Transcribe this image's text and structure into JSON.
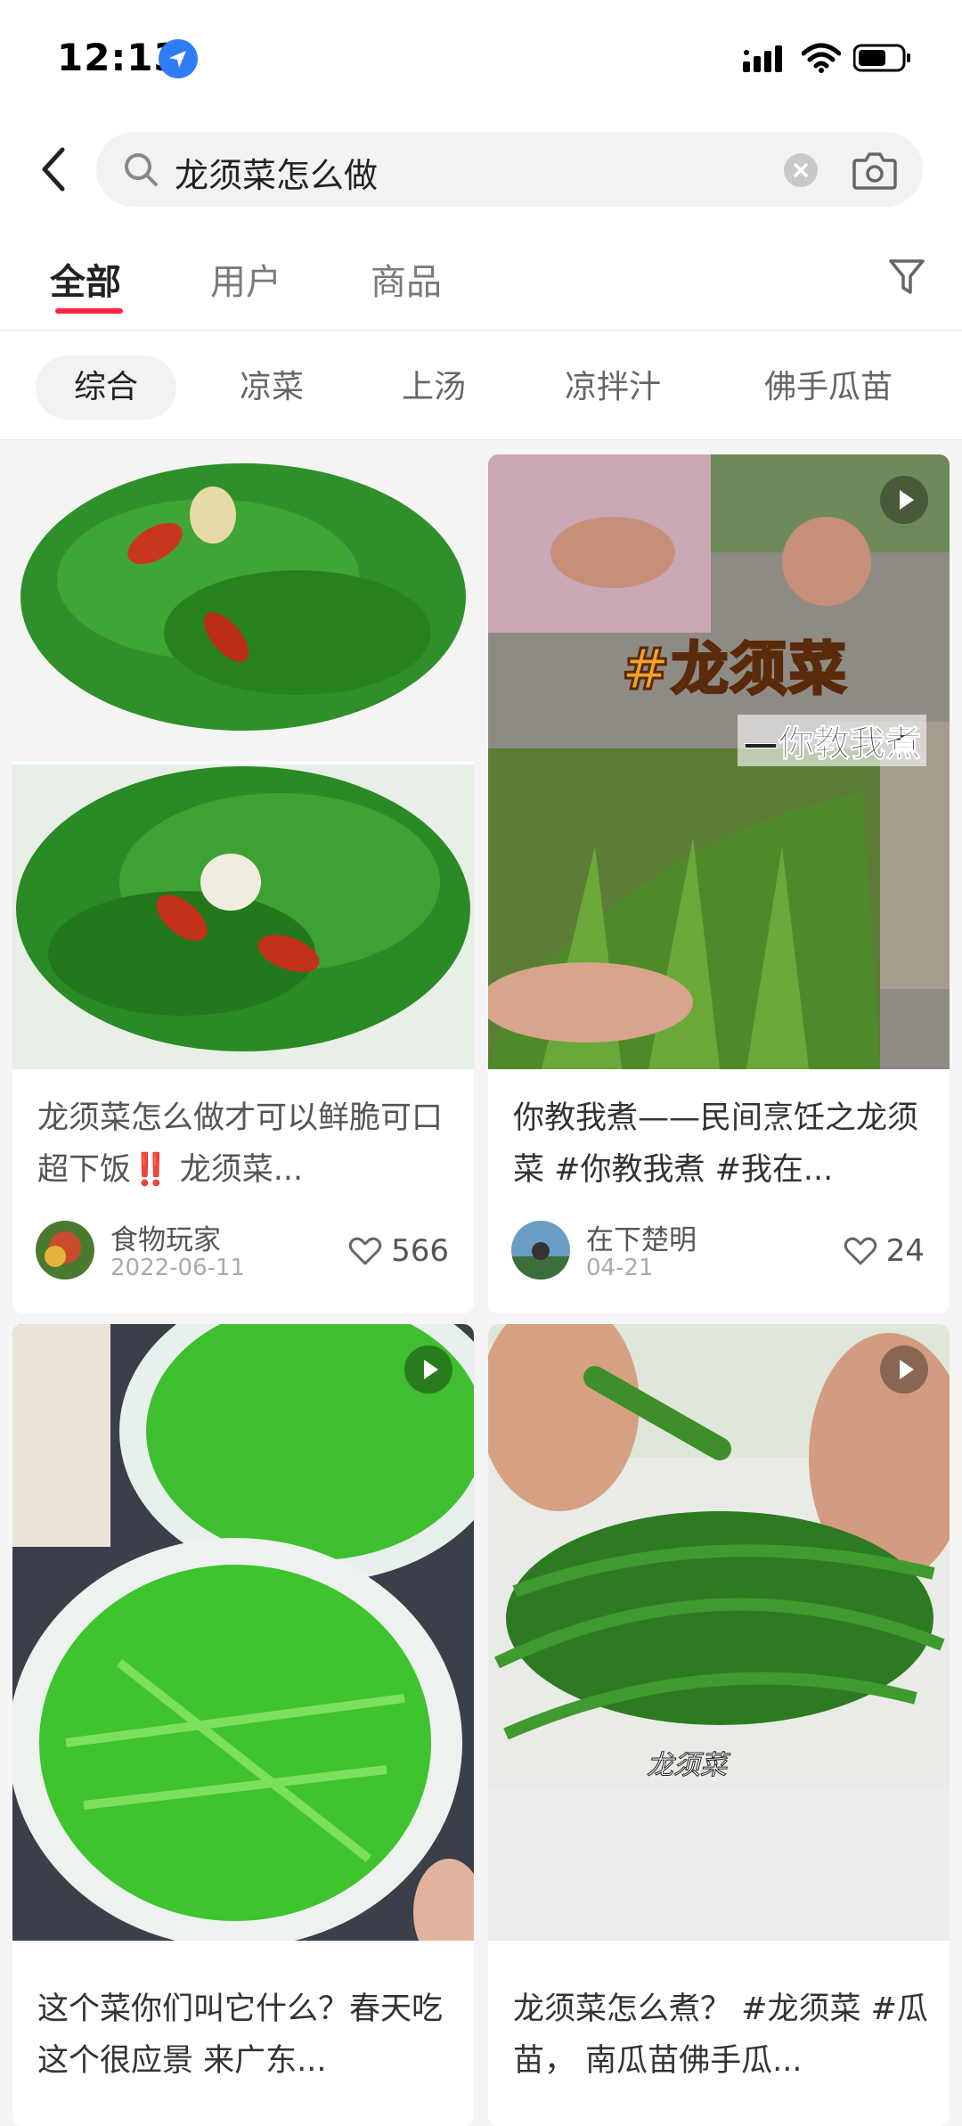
{
  "status": {
    "time": "12:13"
  },
  "search": {
    "query": "龙须菜怎么做"
  },
  "tabs": [
    "全部",
    "用户",
    "商品"
  ],
  "chips": [
    "综合",
    "凉菜",
    "上汤",
    "凉拌汁",
    "佛手瓜苗"
  ],
  "cards": [
    {
      "title": "龙须菜怎么做才可以鲜脆可口超下饭‼️ 龙须菜...",
      "author": "食物玩家",
      "date": "2022-06-11",
      "likes": "566",
      "video": false
    },
    {
      "title": "你教我煮——民间烹饪之龙须菜 #你教我煮 #我在...",
      "author": "在下楚明",
      "date": "04-21",
      "likes": "24",
      "video": true,
      "overlay_main": "#龙须菜",
      "overlay_sub": "—你教我煮"
    },
    {
      "title": "这个菜你们叫它什么？春天吃这个很应景 来广东...",
      "video": true
    },
    {
      "title": "龙须菜怎么煮？ #龙须菜 #瓜苗， 南瓜苗佛手瓜...",
      "video": true,
      "overlay_caption": "龙须菜"
    }
  ],
  "colors": {
    "accent": "#ff2442",
    "location": "#2f7cf6"
  }
}
